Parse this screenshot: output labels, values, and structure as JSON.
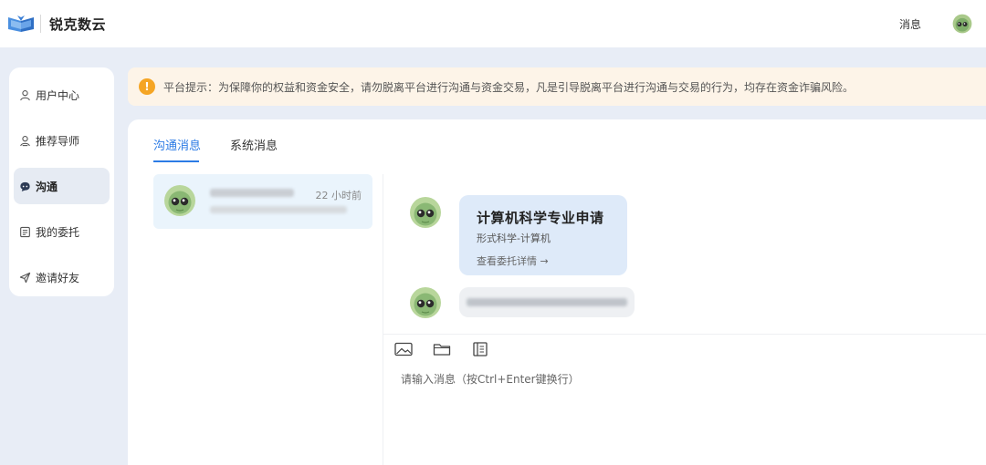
{
  "app": {
    "name": "锐克数云"
  },
  "header": {
    "messages_label": "消息"
  },
  "sidebar": {
    "items": [
      {
        "label": "用户中心",
        "icon": "user-icon"
      },
      {
        "label": "推荐导师",
        "icon": "mentor-icon"
      },
      {
        "label": "沟通",
        "icon": "chat-icon",
        "active": true
      },
      {
        "label": "我的委托",
        "icon": "document-icon"
      },
      {
        "label": "邀请好友",
        "icon": "send-icon"
      }
    ]
  },
  "notice": {
    "text": "平台提示：为保障你的权益和资金安全，请勿脱离平台进行沟通与资金交易，凡是引导脱离平台进行沟通与交易的行为，均存在资金诈骗风险。",
    "color": "#f5a524"
  },
  "tabs": [
    {
      "label": "沟通消息",
      "active": true
    },
    {
      "label": "系统消息",
      "active": false
    }
  ],
  "conversations": [
    {
      "time": "22 小时前"
    }
  ],
  "chat": {
    "card": {
      "title": "计算机科学专业申请",
      "subtitle": "形式科学-计算机",
      "link": "查看委托详情 →"
    },
    "input_placeholder": "请输入消息（按Ctrl+Enter键换行）"
  },
  "colors": {
    "accent": "#2c7be5",
    "background": "#e8edf6",
    "card": "#deeaf9"
  }
}
